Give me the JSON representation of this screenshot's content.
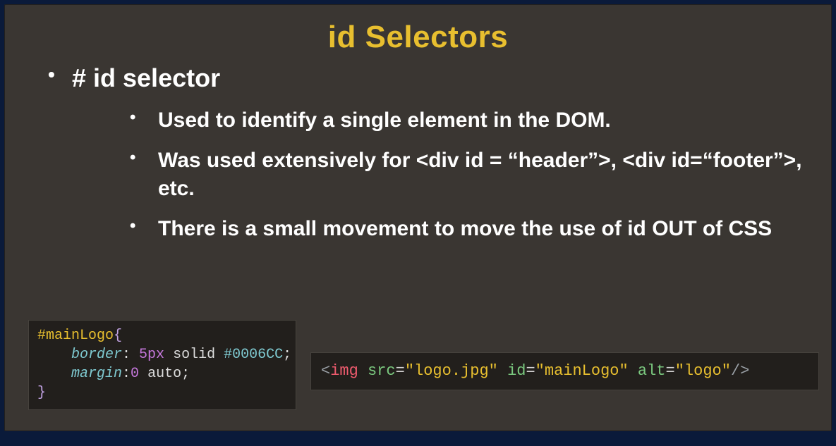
{
  "slide": {
    "title": "id Selectors",
    "bullet_main": "# id selector",
    "sub_bullets": [
      "Used to identify a single element in the DOM.",
      "Was used extensively for <div id = “header”>, <div id=“footer”>, etc.",
      "There is a small movement to move the use of id OUT of CSS"
    ],
    "code_css": {
      "selector": "#mainLogo",
      "brace_open": "{",
      "brace_close": "}",
      "line1_prop": "border",
      "line1_colon": ": ",
      "line1_num": "5px",
      "line1_solid": " solid ",
      "line1_hex": "#0006CC",
      "line1_semi": ";",
      "line2_prop": "margin",
      "line2_colon": ":",
      "line2_zero": "0",
      "line2_auto": " auto",
      "line2_semi": ";"
    },
    "code_html": {
      "open": "<",
      "tag": "img",
      "sp1": " ",
      "attr_src": "src",
      "eq": "=",
      "val_src": "\"logo.jpg\"",
      "sp2": " ",
      "attr_id": "id",
      "val_id": "\"mainLogo\"",
      "sp3": " ",
      "attr_alt": "alt",
      "val_alt": "\"logo\"",
      "close": "/>"
    }
  }
}
